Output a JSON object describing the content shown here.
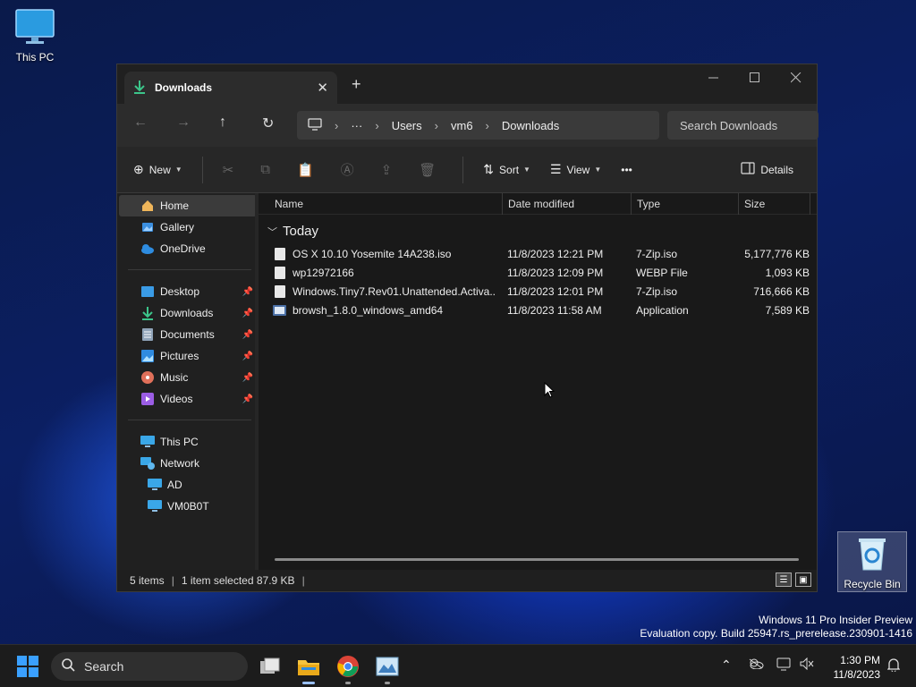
{
  "desktop": {
    "this_pc_label": "This PC",
    "recycle_bin_label": "Recycle Bin",
    "watermark_line1": "Windows 11 Pro Insider Preview",
    "watermark_line2": "Evaluation copy. Build 25947.rs_prerelease.230901-1416"
  },
  "window": {
    "tab_title": "Downloads",
    "new_tab_glyph": "+",
    "close_tab_glyph": "✕"
  },
  "address": {
    "crumbs": [
      "Users",
      "vm6",
      "Downloads"
    ],
    "search_placeholder": "Search Downloads"
  },
  "toolbar": {
    "new_label": "New",
    "sort_label": "Sort",
    "view_label": "View",
    "more_label": "•••",
    "details_label": "Details"
  },
  "sidebar": {
    "top": [
      {
        "label": "Home",
        "icon": "home-icon",
        "selected": true
      },
      {
        "label": "Gallery",
        "icon": "gallery-icon"
      },
      {
        "label": "OneDrive",
        "icon": "cloud-icon"
      }
    ],
    "pinned": [
      {
        "label": "Desktop",
        "icon": "desktop-icon"
      },
      {
        "label": "Downloads",
        "icon": "download-icon"
      },
      {
        "label": "Documents",
        "icon": "document-icon"
      },
      {
        "label": "Pictures",
        "icon": "picture-icon"
      },
      {
        "label": "Music",
        "icon": "music-icon"
      },
      {
        "label": "Videos",
        "icon": "video-icon"
      }
    ],
    "bottom": [
      {
        "label": "This PC",
        "icon": "computer-icon"
      },
      {
        "label": "Network",
        "icon": "network-icon"
      },
      {
        "label": "AD",
        "icon": "computer-icon",
        "indent": true
      },
      {
        "label": "VM0B0T",
        "icon": "computer-icon",
        "indent": true
      }
    ]
  },
  "files": {
    "columns": {
      "name": "Name",
      "date": "Date modified",
      "type": "Type",
      "size": "Size"
    },
    "group_label": "Today",
    "rows": [
      {
        "name": "OS X 10.10 Yosemite 14A238.iso",
        "date": "11/8/2023 12:21 PM",
        "type": "7-Zip.iso",
        "size": "5,177,776 KB"
      },
      {
        "name": "wp12972166",
        "date": "11/8/2023 12:09 PM",
        "type": "WEBP File",
        "size": "1,093 KB"
      },
      {
        "name": "Windows.Tiny7.Rev01.Unattended.Activa...",
        "date": "11/8/2023 12:01 PM",
        "type": "7-Zip.iso",
        "size": "716,666 KB"
      },
      {
        "name": "browsh_1.8.0_windows_amd64",
        "date": "11/8/2023 11:58 AM",
        "type": "Application",
        "size": "7,589 KB"
      }
    ]
  },
  "status": {
    "items_count": "5 items",
    "selection": "1 item selected  87.9 KB"
  },
  "taskbar": {
    "search_label": "Search",
    "time": "1:30 PM",
    "date": "11/8/2023"
  }
}
